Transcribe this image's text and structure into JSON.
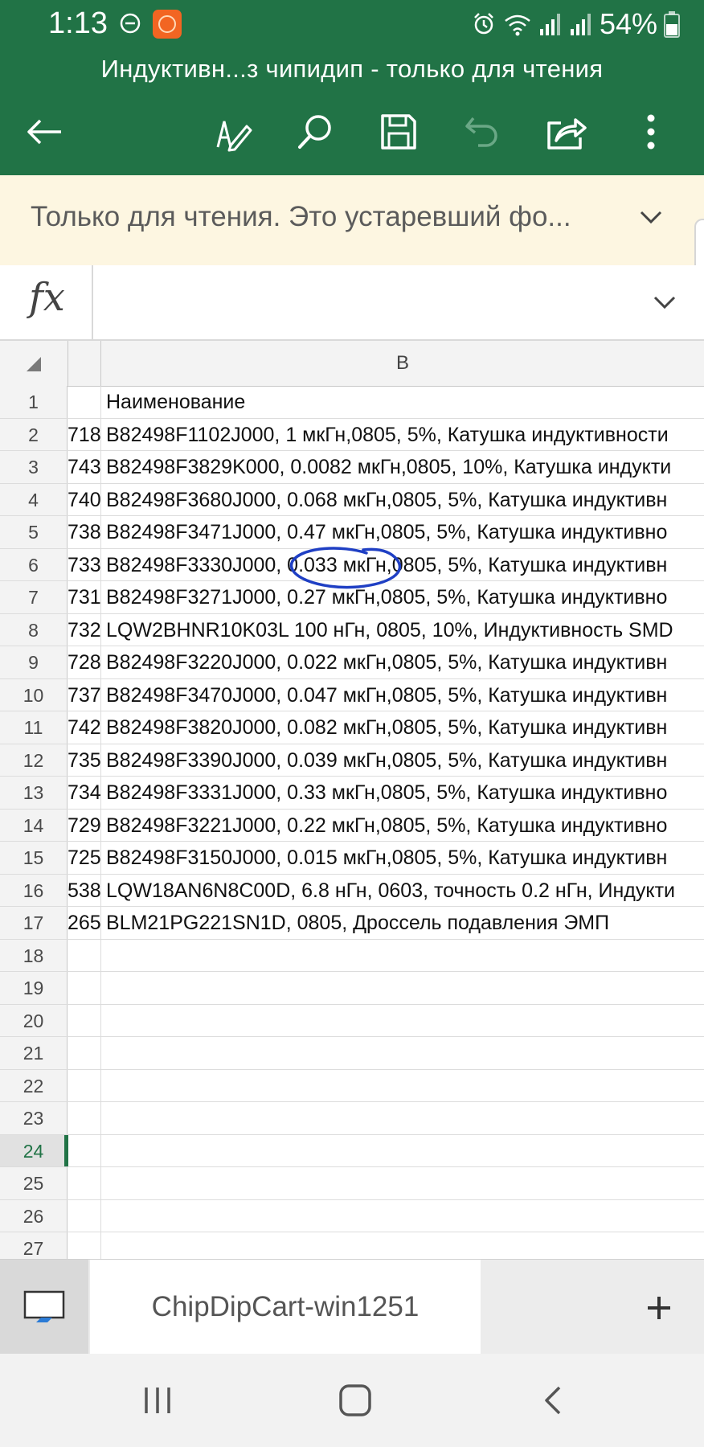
{
  "status_bar": {
    "time": "1:13",
    "battery": "54%",
    "icons": [
      "dnd-icon",
      "app-notification-icon",
      "alarm-icon",
      "wifi-icon",
      "signal-icon",
      "signal-icon",
      "battery-icon"
    ]
  },
  "title_bar": {
    "title": "Индуктивн...з чипидип - только для чтения",
    "actions": [
      "back-icon",
      "edit-icon",
      "search-icon",
      "save-icon",
      "undo-icon",
      "share-icon",
      "more-icon"
    ],
    "color": "#217346"
  },
  "banner": {
    "text": "Только для чтения. Это устаревший фо...",
    "background": "#fdf6e1"
  },
  "formula_bar": {
    "label": "fx",
    "value": ""
  },
  "grid": {
    "column_header": "B",
    "rows": [
      {
        "num": "1",
        "a": "",
        "b": "Наименование"
      },
      {
        "num": "2",
        "a": "718",
        "b": "B82498F1102J000, 1 мкГн,0805, 5%, Катушка индуктивности"
      },
      {
        "num": "3",
        "a": "743",
        "b": "B82498F3829K000, 0.0082 мкГн,0805, 10%, Катушка индукти"
      },
      {
        "num": "4",
        "a": "740",
        "b": "B82498F3680J000, 0.068 мкГн,0805, 5%, Катушка индуктивн"
      },
      {
        "num": "5",
        "a": "738",
        "b": "B82498F3471J000, 0.47 мкГн,0805, 5%, Катушка индуктивно"
      },
      {
        "num": "6",
        "a": "733",
        "b": "B82498F3330J000, 0.033 мкГн,0805, 5%, Катушка индуктивн"
      },
      {
        "num": "7",
        "a": "731",
        "b": "B82498F3271J000, 0.27 мкГн,0805, 5%, Катушка индуктивно"
      },
      {
        "num": "8",
        "a": "732",
        "b": "LQW2BHNR10K03L 100 нГн, 0805, 10%, Индуктивность SMD"
      },
      {
        "num": "9",
        "a": "728",
        "b": "B82498F3220J000, 0.022 мкГн,0805, 5%, Катушка индуктивн"
      },
      {
        "num": "10",
        "a": "737",
        "b": "B82498F3470J000, 0.047 мкГн,0805, 5%, Катушка индуктивн"
      },
      {
        "num": "11",
        "a": "742",
        "b": "B82498F3820J000, 0.082 мкГн,0805, 5%, Катушка индуктивн"
      },
      {
        "num": "12",
        "a": "735",
        "b": "B82498F3390J000, 0.039 мкГн,0805, 5%, Катушка индуктивн"
      },
      {
        "num": "13",
        "a": "734",
        "b": "B82498F3331J000, 0.33 мкГн,0805, 5%, Катушка индуктивно"
      },
      {
        "num": "14",
        "a": "729",
        "b": "B82498F3221J000, 0.22 мкГн,0805, 5%, Катушка индуктивно"
      },
      {
        "num": "15",
        "a": "725",
        "b": "B82498F3150J000, 0.015 мкГн,0805, 5%, Катушка индуктивн"
      },
      {
        "num": "16",
        "a": "538",
        "b": "LQW18AN6N8C00D, 6.8 нГн, 0603, точность 0.2 нГн, Индукти"
      },
      {
        "num": "17",
        "a": "265",
        "b": "BLM21PG221SN1D, 0805, Дроссель подавления ЭМП"
      },
      {
        "num": "18",
        "a": "",
        "b": ""
      },
      {
        "num": "19",
        "a": "",
        "b": ""
      },
      {
        "num": "20",
        "a": "",
        "b": ""
      },
      {
        "num": "21",
        "a": "",
        "b": ""
      },
      {
        "num": "22",
        "a": "",
        "b": ""
      },
      {
        "num": "23",
        "a": "",
        "b": ""
      },
      {
        "num": "24",
        "a": "",
        "b": "",
        "selected": true
      },
      {
        "num": "25",
        "a": "",
        "b": ""
      },
      {
        "num": "26",
        "a": "",
        "b": ""
      },
      {
        "num": "27",
        "a": "",
        "b": ""
      }
    ],
    "annotation_color": "#1f3fc4"
  },
  "sheets": {
    "active_tab": "ChipDipCart-win1251",
    "add_label": "+"
  },
  "nav_bar": {
    "buttons": [
      "recents-icon",
      "home-icon",
      "back-nav-icon"
    ]
  }
}
